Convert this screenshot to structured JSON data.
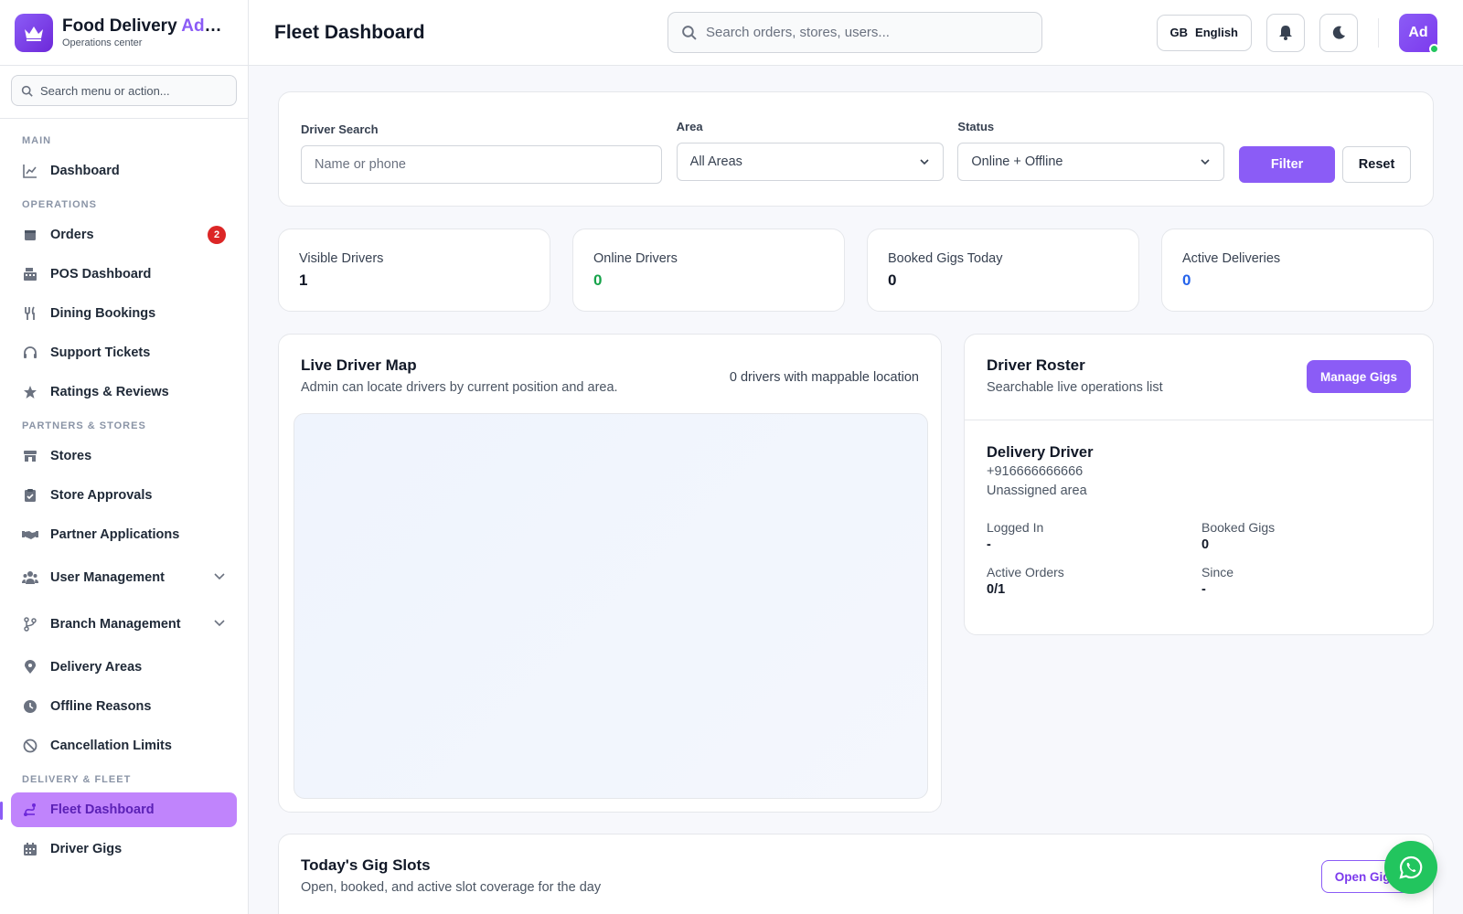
{
  "brand": {
    "title_main": "Food Delivery ",
    "title_accent": "Admin",
    "subtitle": "Operations center"
  },
  "sidebar": {
    "search_placeholder": "Search menu or action...",
    "sections": {
      "main": "MAIN",
      "operations": "OPERATIONS",
      "partners": "PARTNERS & STORES",
      "delivery": "DELIVERY & FLEET"
    },
    "items": {
      "dashboard": "Dashboard",
      "orders": "Orders",
      "orders_badge": "2",
      "pos": "POS Dashboard",
      "dining": "Dining Bookings",
      "support": "Support Tickets",
      "ratings": "Ratings & Reviews",
      "stores": "Stores",
      "store_approvals": "Store Approvals",
      "partner_apps": "Partner Applications",
      "user_mgmt": "User Management",
      "branch_mgmt": "Branch Management",
      "delivery_areas": "Delivery Areas",
      "offline_reasons": "Offline Reasons",
      "cancellation_limits": "Cancellation Limits",
      "fleet_dashboard": "Fleet Dashboard",
      "driver_gigs": "Driver Gigs"
    }
  },
  "header": {
    "title": "Fleet Dashboard",
    "search_placeholder": "Search orders, stores, users...",
    "lang_flag": "GB",
    "lang_label": "English",
    "avatar": "Ad"
  },
  "filters": {
    "driver_search_label": "Driver Search",
    "driver_search_placeholder": "Name or phone",
    "area_label": "Area",
    "area_value": "All Areas",
    "status_label": "Status",
    "status_value": "Online + Offline",
    "filter_btn": "Filter",
    "reset_btn": "Reset"
  },
  "stats": {
    "visible_label": "Visible Drivers",
    "visible_value": "1",
    "online_label": "Online Drivers",
    "online_value": "0",
    "gigs_label": "Booked Gigs Today",
    "gigs_value": "0",
    "active_label": "Active Deliveries",
    "active_value": "0"
  },
  "map": {
    "title": "Live Driver Map",
    "subtitle": "Admin can locate drivers by current position and area.",
    "count": "0 drivers with mappable location"
  },
  "roster": {
    "title": "Driver Roster",
    "subtitle": "Searchable live operations list",
    "manage_btn": "Manage Gigs",
    "driver": {
      "name": "Delivery Driver",
      "phone": "+916666666666",
      "area": "Unassigned area",
      "logged_in_label": "Logged In",
      "logged_in_value": "-",
      "booked_label": "Booked Gigs",
      "booked_value": "0",
      "active_label": "Active Orders",
      "active_value": "0/1",
      "since_label": "Since",
      "since_value": "-"
    }
  },
  "gigs": {
    "title": "Today's Gig Slots",
    "subtitle": "Open, booked, and active slot coverage for the day",
    "open_btn": "Open Gigs"
  },
  "colors": {
    "accent": "#8b5cf6",
    "online_green": "#16a34a",
    "active_blue": "#2563eb",
    "badge_red": "#dc2626"
  }
}
